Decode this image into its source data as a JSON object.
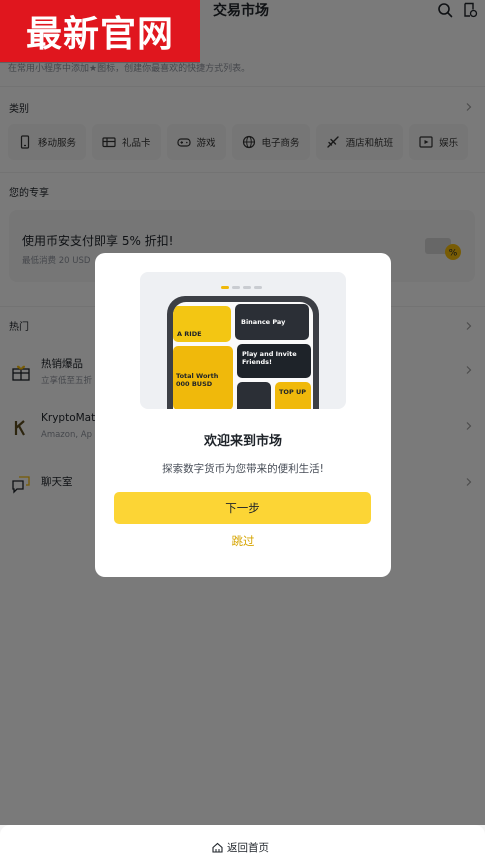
{
  "header": {
    "brand_label": "最新官网",
    "title": "交易市场",
    "hint": "在常用小程序中添加★图标，创建你最喜欢的快捷方式列表。"
  },
  "categories": {
    "title": "类别",
    "items": [
      {
        "label": "移动服务",
        "icon": "phone-icon"
      },
      {
        "label": "礼品卡",
        "icon": "gift-card-icon"
      },
      {
        "label": "游戏",
        "icon": "gamepad-icon"
      },
      {
        "label": "电子商务",
        "icon": "globe-icon"
      },
      {
        "label": "酒店和航班",
        "icon": "plane-icon"
      },
      {
        "label": "娱乐",
        "icon": "play-icon"
      }
    ]
  },
  "exclusive": {
    "title": "您的专享",
    "promo_title": "使用币安支付即享 5% 折扣!",
    "promo_sub": "最低消费 20 USD"
  },
  "hot": {
    "title": "热门",
    "items": [
      {
        "title": "热销爆品",
        "sub": "立享低至五折",
        "icon": "gift-icon"
      },
      {
        "title": "KryptoMat",
        "sub": "Amazon, Ap",
        "icon": "kryptomat-logo-icon"
      },
      {
        "title": "聊天室",
        "sub": "",
        "icon": "chat-icon"
      }
    ]
  },
  "dialog": {
    "title": "欢迎来到市场",
    "subtitle": "探索数字货币为您带来的便利生活!",
    "next_label": "下一步",
    "skip_label": "跳过",
    "illustration": {
      "cards": [
        "A RIDE",
        "Binance Pay",
        "Play and Invite Friends!",
        "Total Worth 000 BUSD",
        "TOP UP"
      ]
    }
  },
  "bottom": {
    "home_label": "返回首页"
  },
  "colors": {
    "accent": "#fcd535",
    "skip": "#d6a400",
    "brand": "#e0161e"
  }
}
